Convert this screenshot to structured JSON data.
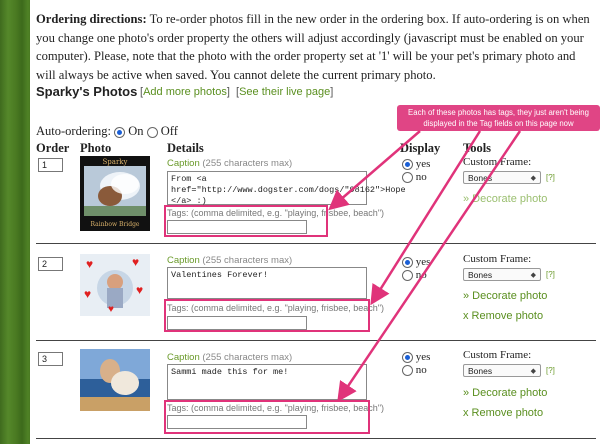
{
  "directions": {
    "heading": "Ordering directions:",
    "text": "To re-order photos fill in the new order in the ordering box. If auto-ordering is on when you change one photo's order property the others will adjust accordingly (javascript must be enabled on your computer). Please, note that the photo with the order property set at '1' will be your pet's primary photo and will always be active when saved. You cannot delete the current primary photo."
  },
  "section": {
    "title": "Sparky's Photos",
    "add_link": "Add more photos",
    "live_link": "See their live page"
  },
  "auto_ordering": {
    "label": "Auto-ordering:",
    "on": "On",
    "off": "Off",
    "selected": "On"
  },
  "headers": {
    "order": "Order",
    "photo": "Photo",
    "details": "Details",
    "display": "Display",
    "tools": "Tools"
  },
  "callout": "Each of these photos has tags, they just aren't being displayed in the Tag fields on this page now",
  "labels": {
    "caption": "Caption",
    "caption_hint": "(255 characters max)",
    "tags": "Tags:",
    "tags_hint": "(comma delimited, e.g. \"playing, frisbee, beach\")",
    "yes": "yes",
    "no": "no",
    "custom_frame": "Custom Frame:",
    "help": "[?]",
    "decorate": "» Decorate photo",
    "remove": "x Remove photo"
  },
  "photos": [
    {
      "order": "1",
      "caption": "From <a\nhref=\"http://www.dogster.com/dogs/\"98162\">Hope\n</a> :)",
      "display": "yes",
      "frame": "Bones",
      "photo_text_top": "Sparky",
      "photo_text_bottom": "Rainbow Bridge"
    },
    {
      "order": "2",
      "caption": "Valentines Forever!",
      "display": "yes",
      "frame": "Bones"
    },
    {
      "order": "3",
      "caption": "Sammi made this for me!",
      "display": "yes",
      "frame": "Bones"
    }
  ],
  "colors": {
    "highlight": "#e0337a",
    "link": "#5a8f1f",
    "background_grass": "#4a7a22"
  }
}
